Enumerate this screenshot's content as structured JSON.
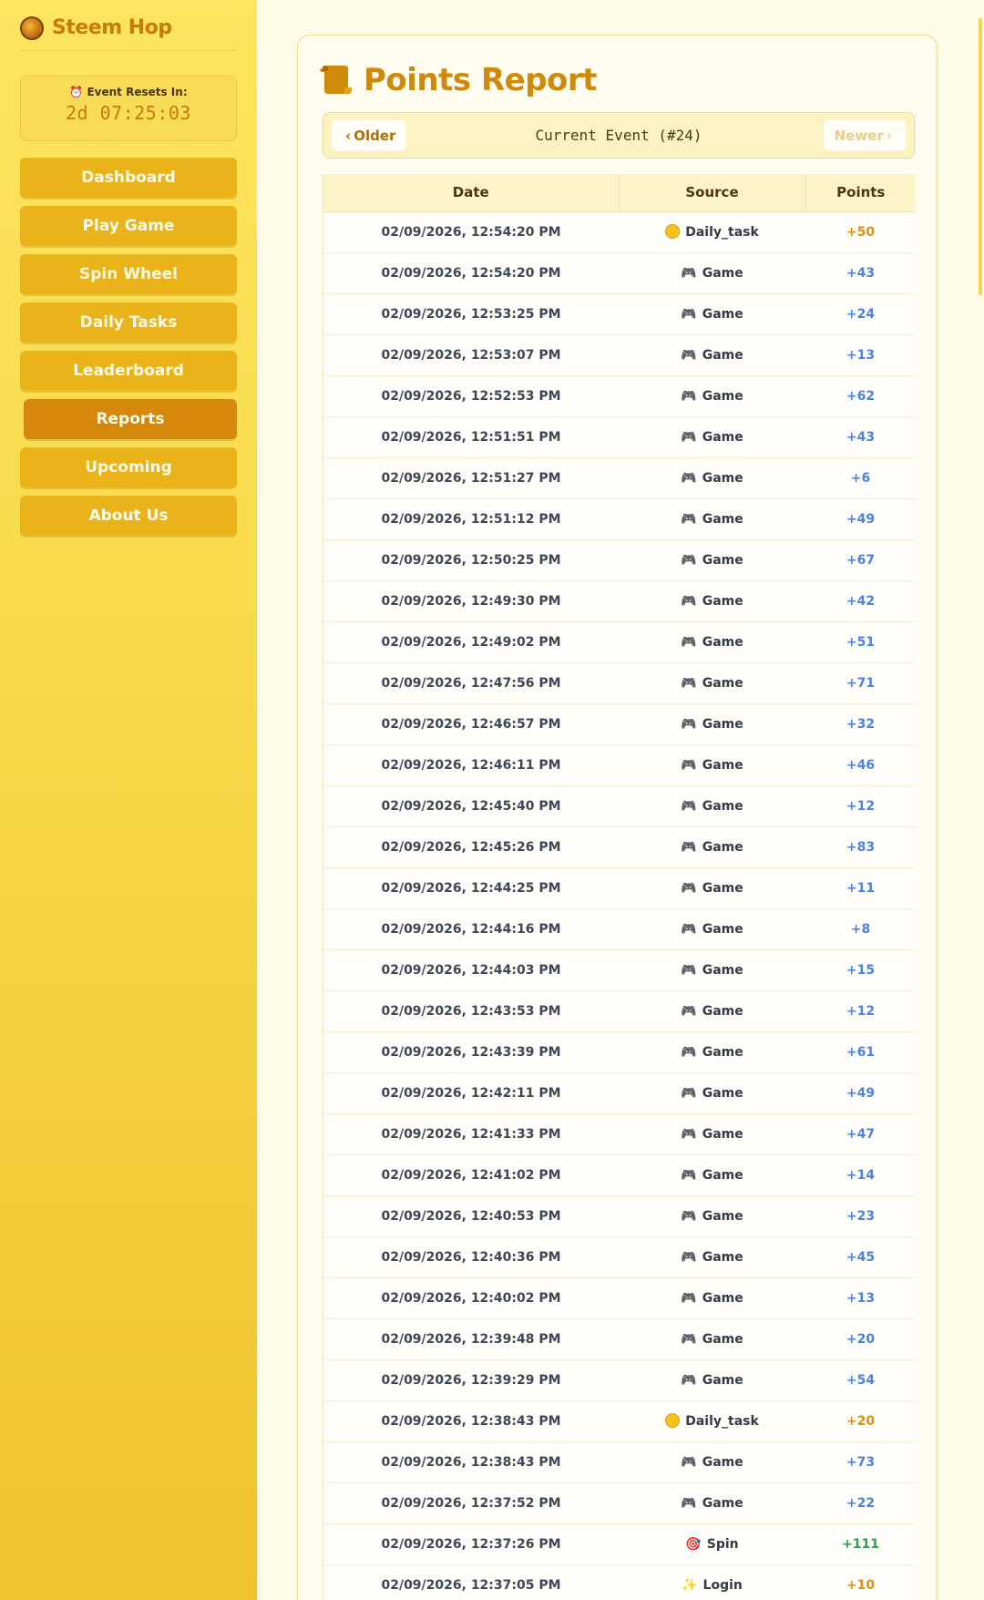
{
  "brand": {
    "name": "Steem Hop",
    "logo_text": "STEEM HOP"
  },
  "timer": {
    "label": "⏰ Event Resets In:",
    "value": "2d 07:25:03"
  },
  "nav": [
    {
      "label": "Dashboard",
      "active": false
    },
    {
      "label": "Play Game",
      "active": false
    },
    {
      "label": "Spin Wheel",
      "active": false
    },
    {
      "label": "Daily Tasks",
      "active": false
    },
    {
      "label": "Leaderboard",
      "active": false
    },
    {
      "label": "Reports",
      "active": true
    },
    {
      "label": "Upcoming",
      "active": false
    },
    {
      "label": "About Us",
      "active": false
    }
  ],
  "page": {
    "title": "Points Report"
  },
  "pager": {
    "older": "Older",
    "newer": "Newer",
    "current": "Current Event (#24)"
  },
  "table": {
    "headers": [
      "Date",
      "Source",
      "Points"
    ],
    "rows": [
      {
        "date": "02/09/2026, 12:54:20 PM",
        "source": "Daily_task",
        "icon": "coin-icon",
        "points": "+50",
        "kind": "daily"
      },
      {
        "date": "02/09/2026, 12:54:20 PM",
        "source": "Game",
        "icon": "gamepad-icon",
        "points": "+43",
        "kind": "game"
      },
      {
        "date": "02/09/2026, 12:53:25 PM",
        "source": "Game",
        "icon": "gamepad-icon",
        "points": "+24",
        "kind": "game"
      },
      {
        "date": "02/09/2026, 12:53:07 PM",
        "source": "Game",
        "icon": "gamepad-icon",
        "points": "+13",
        "kind": "game"
      },
      {
        "date": "02/09/2026, 12:52:53 PM",
        "source": "Game",
        "icon": "gamepad-icon",
        "points": "+62",
        "kind": "game"
      },
      {
        "date": "02/09/2026, 12:51:51 PM",
        "source": "Game",
        "icon": "gamepad-icon",
        "points": "+43",
        "kind": "game"
      },
      {
        "date": "02/09/2026, 12:51:27 PM",
        "source": "Game",
        "icon": "gamepad-icon",
        "points": "+6",
        "kind": "game"
      },
      {
        "date": "02/09/2026, 12:51:12 PM",
        "source": "Game",
        "icon": "gamepad-icon",
        "points": "+49",
        "kind": "game"
      },
      {
        "date": "02/09/2026, 12:50:25 PM",
        "source": "Game",
        "icon": "gamepad-icon",
        "points": "+67",
        "kind": "game"
      },
      {
        "date": "02/09/2026, 12:49:30 PM",
        "source": "Game",
        "icon": "gamepad-icon",
        "points": "+42",
        "kind": "game"
      },
      {
        "date": "02/09/2026, 12:49:02 PM",
        "source": "Game",
        "icon": "gamepad-icon",
        "points": "+51",
        "kind": "game"
      },
      {
        "date": "02/09/2026, 12:47:56 PM",
        "source": "Game",
        "icon": "gamepad-icon",
        "points": "+71",
        "kind": "game"
      },
      {
        "date": "02/09/2026, 12:46:57 PM",
        "source": "Game",
        "icon": "gamepad-icon",
        "points": "+32",
        "kind": "game"
      },
      {
        "date": "02/09/2026, 12:46:11 PM",
        "source": "Game",
        "icon": "gamepad-icon",
        "points": "+46",
        "kind": "game"
      },
      {
        "date": "02/09/2026, 12:45:40 PM",
        "source": "Game",
        "icon": "gamepad-icon",
        "points": "+12",
        "kind": "game"
      },
      {
        "date": "02/09/2026, 12:45:26 PM",
        "source": "Game",
        "icon": "gamepad-icon",
        "points": "+83",
        "kind": "game"
      },
      {
        "date": "02/09/2026, 12:44:25 PM",
        "source": "Game",
        "icon": "gamepad-icon",
        "points": "+11",
        "kind": "game"
      },
      {
        "date": "02/09/2026, 12:44:16 PM",
        "source": "Game",
        "icon": "gamepad-icon",
        "points": "+8",
        "kind": "game"
      },
      {
        "date": "02/09/2026, 12:44:03 PM",
        "source": "Game",
        "icon": "gamepad-icon",
        "points": "+15",
        "kind": "game"
      },
      {
        "date": "02/09/2026, 12:43:53 PM",
        "source": "Game",
        "icon": "gamepad-icon",
        "points": "+12",
        "kind": "game"
      },
      {
        "date": "02/09/2026, 12:43:39 PM",
        "source": "Game",
        "icon": "gamepad-icon",
        "points": "+61",
        "kind": "game"
      },
      {
        "date": "02/09/2026, 12:42:11 PM",
        "source": "Game",
        "icon": "gamepad-icon",
        "points": "+49",
        "kind": "game"
      },
      {
        "date": "02/09/2026, 12:41:33 PM",
        "source": "Game",
        "icon": "gamepad-icon",
        "points": "+47",
        "kind": "game"
      },
      {
        "date": "02/09/2026, 12:41:02 PM",
        "source": "Game",
        "icon": "gamepad-icon",
        "points": "+14",
        "kind": "game"
      },
      {
        "date": "02/09/2026, 12:40:53 PM",
        "source": "Game",
        "icon": "gamepad-icon",
        "points": "+23",
        "kind": "game"
      },
      {
        "date": "02/09/2026, 12:40:36 PM",
        "source": "Game",
        "icon": "gamepad-icon",
        "points": "+45",
        "kind": "game"
      },
      {
        "date": "02/09/2026, 12:40:02 PM",
        "source": "Game",
        "icon": "gamepad-icon",
        "points": "+13",
        "kind": "game"
      },
      {
        "date": "02/09/2026, 12:39:48 PM",
        "source": "Game",
        "icon": "gamepad-icon",
        "points": "+20",
        "kind": "game"
      },
      {
        "date": "02/09/2026, 12:39:29 PM",
        "source": "Game",
        "icon": "gamepad-icon",
        "points": "+54",
        "kind": "game"
      },
      {
        "date": "02/09/2026, 12:38:43 PM",
        "source": "Daily_task",
        "icon": "coin-icon",
        "points": "+20",
        "kind": "daily"
      },
      {
        "date": "02/09/2026, 12:38:43 PM",
        "source": "Game",
        "icon": "gamepad-icon",
        "points": "+73",
        "kind": "game"
      },
      {
        "date": "02/09/2026, 12:37:52 PM",
        "source": "Game",
        "icon": "gamepad-icon",
        "points": "+22",
        "kind": "game"
      },
      {
        "date": "02/09/2026, 12:37:26 PM",
        "source": "Spin",
        "icon": "target-icon",
        "points": "+111",
        "kind": "spin"
      },
      {
        "date": "02/09/2026, 12:37:05 PM",
        "source": "Login",
        "icon": "sparkles-icon",
        "points": "+10",
        "kind": "login"
      }
    ]
  }
}
